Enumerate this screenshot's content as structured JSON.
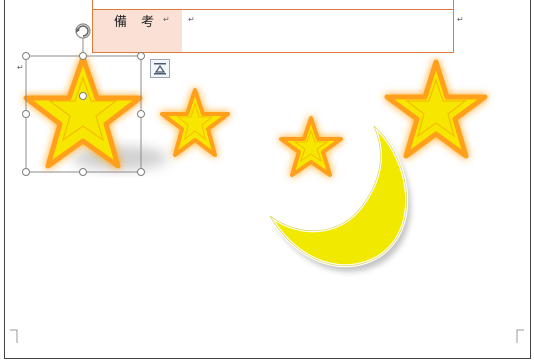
{
  "table": {
    "label_cell": "備考",
    "label_mark": "↵",
    "value_mark": "↵",
    "row_end_mark": "↵"
  },
  "document": {
    "paragraph_mark": "↵"
  },
  "icons": {
    "rotate": "rotate-handle-icon",
    "layout_options": "layout-options-icon"
  },
  "colors": {
    "star_fill": "#f7e600",
    "star_glow": "#ff9f1a",
    "moon_fill": "#f1ea00",
    "table_border": "#e07a3a",
    "label_cell_bg": "#fbe1d5",
    "selection_handle": "#888888"
  },
  "shapes": {
    "stars": [
      {
        "name": "star-large-selected",
        "selected": true
      },
      {
        "name": "star-medium"
      },
      {
        "name": "star-small"
      },
      {
        "name": "star-large-right"
      }
    ],
    "moon": {
      "name": "crescent-moon"
    }
  }
}
